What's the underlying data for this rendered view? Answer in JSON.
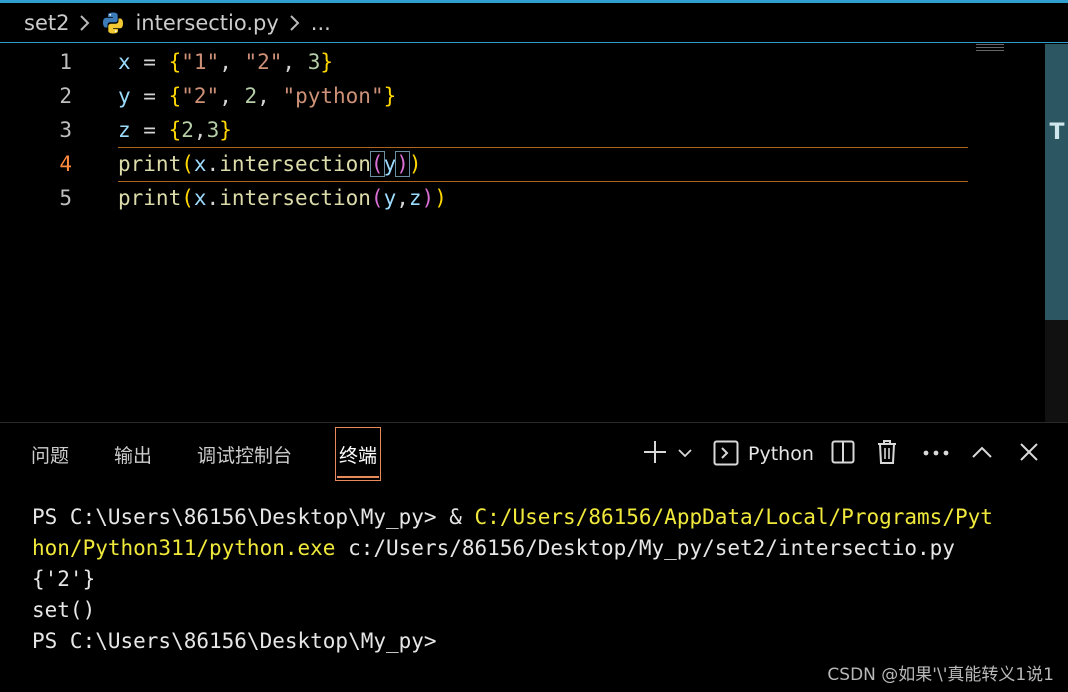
{
  "breadcrumb": {
    "folder": "set2",
    "file": "intersectio.py",
    "more": "..."
  },
  "editor": {
    "active_line": 4,
    "lines": [
      {
        "num": "1",
        "tokens": [
          {
            "t": "x",
            "c": "v"
          },
          {
            "t": " = ",
            "c": "op"
          },
          {
            "t": "{",
            "c": "b1"
          },
          {
            "t": "\"1\"",
            "c": "s"
          },
          {
            "t": ", ",
            "c": "op"
          },
          {
            "t": "\"2\"",
            "c": "s"
          },
          {
            "t": ", ",
            "c": "op"
          },
          {
            "t": "3",
            "c": "n"
          },
          {
            "t": "}",
            "c": "b1"
          }
        ]
      },
      {
        "num": "2",
        "tokens": [
          {
            "t": "y",
            "c": "v"
          },
          {
            "t": " = ",
            "c": "op"
          },
          {
            "t": "{",
            "c": "b1"
          },
          {
            "t": "\"2\"",
            "c": "s"
          },
          {
            "t": ", ",
            "c": "op"
          },
          {
            "t": "2",
            "c": "n"
          },
          {
            "t": ", ",
            "c": "op"
          },
          {
            "t": "\"python\"",
            "c": "s"
          },
          {
            "t": "}",
            "c": "b1"
          }
        ]
      },
      {
        "num": "3",
        "tokens": [
          {
            "t": "z",
            "c": "v"
          },
          {
            "t": " = ",
            "c": "op"
          },
          {
            "t": "{",
            "c": "b1"
          },
          {
            "t": "2",
            "c": "n"
          },
          {
            "t": ",",
            "c": "op"
          },
          {
            "t": "3",
            "c": "n"
          },
          {
            "t": "}",
            "c": "b1"
          }
        ]
      },
      {
        "num": "4",
        "tokens": [
          {
            "t": "print",
            "c": "f"
          },
          {
            "t": "(",
            "c": "b1"
          },
          {
            "t": "x",
            "c": "v"
          },
          {
            "t": ".",
            "c": "op"
          },
          {
            "t": "intersection",
            "c": "f"
          },
          {
            "t": "(",
            "c": "b2 bm"
          },
          {
            "t": "y",
            "c": "v"
          },
          {
            "t": ")",
            "c": "b2 bm"
          },
          {
            "t": ")",
            "c": "b1"
          }
        ]
      },
      {
        "num": "5",
        "tokens": [
          {
            "t": "print",
            "c": "f"
          },
          {
            "t": "(",
            "c": "b1"
          },
          {
            "t": "x",
            "c": "v"
          },
          {
            "t": ".",
            "c": "op"
          },
          {
            "t": "intersection",
            "c": "f"
          },
          {
            "t": "(",
            "c": "b2"
          },
          {
            "t": "y",
            "c": "v"
          },
          {
            "t": ",",
            "c": "op"
          },
          {
            "t": "z",
            "c": "v"
          },
          {
            "t": ")",
            "c": "b2"
          },
          {
            "t": ")",
            "c": "b1"
          }
        ]
      }
    ]
  },
  "panel": {
    "tabs": [
      "问题",
      "输出",
      "调试控制台",
      "终端"
    ],
    "active_tab": "终端",
    "shell_label": "Python"
  },
  "terminal": {
    "prompt": "PS C:\\Users\\86156\\Desktop\\My_py> ",
    "amp": "& ",
    "cmd_path_1": "C:/Users/86156/AppData/Local/Programs/Pyt",
    "cmd_path_2": "hon/Python311/python.exe",
    "cmd_arg": " c:/Users/86156/Desktop/My_py/set2/intersectio.py",
    "output_1": "{'2'}",
    "output_2": "set()",
    "final_prompt": "PS C:\\Users\\86156\\Desktop\\My_py>"
  },
  "watermark": "CSDN @如果'\\'真能转义1说1",
  "colors": {
    "accent": "#2f9fd0",
    "active_tab_border": "#e88a5a",
    "terminal_path": "#f0e93b"
  }
}
